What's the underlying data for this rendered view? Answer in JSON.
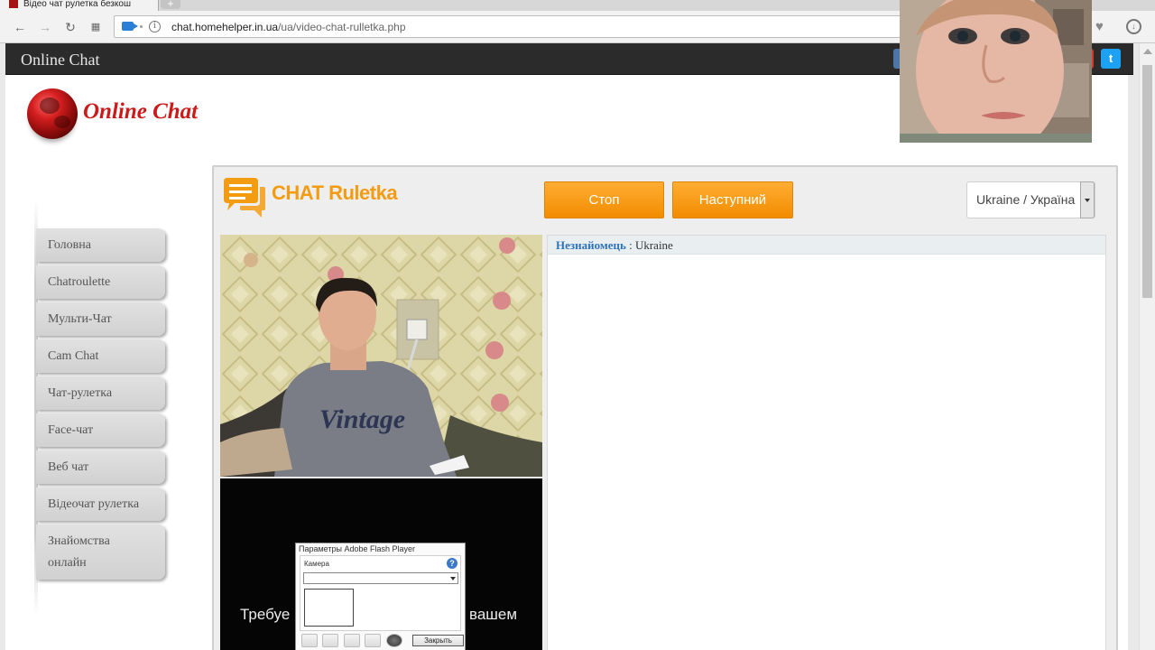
{
  "browser": {
    "tab_title": "Відео чат рулетка безкош",
    "url_host": "chat.homehelper.in.ua",
    "url_path": "/ua/video-chat-rulletka.php",
    "info_glyph": "i"
  },
  "site": {
    "bar_title": "Online Chat",
    "logo_text": "Online Chat",
    "twitter_glyph": "t"
  },
  "sidebar": {
    "items": [
      {
        "label": "Головна"
      },
      {
        "label": "Chatroulette"
      },
      {
        "label": "Мульти-Чат"
      },
      {
        "label": "Cam Chat"
      },
      {
        "label": "Чат-рулетка"
      },
      {
        "label": "Face-чат"
      },
      {
        "label": "Веб чат"
      },
      {
        "label": "Відеочат рулетка"
      },
      {
        "label": "Знайомства онлайн"
      }
    ]
  },
  "chat": {
    "brand": "CHAT Ruletka",
    "stop_label": "Стоп",
    "next_label": "Наступний",
    "country": "Ukraine / Україна",
    "log": [
      {
        "user": "Незнайомець",
        "text": " : Ukraine"
      }
    ],
    "local_video_text_left": "Требуе",
    "local_video_text_right": "вашем"
  },
  "flash_dialog": {
    "title": "Параметры Adobe Flash Player",
    "tab": "Камера",
    "help_glyph": "?",
    "close_label": "Закрыть"
  },
  "colors": {
    "accent_orange": "#f39c12",
    "logo_red": "#cc1a1a",
    "username_blue": "#2f73b8",
    "site_bar": "#2b2b2b"
  },
  "icons": [
    "back-icon",
    "forward-icon",
    "reload-icon",
    "apps-icon",
    "camera-icon",
    "info-icon",
    "heart-icon",
    "download-icon",
    "chat-bubbles-icon",
    "twitter-icon"
  ]
}
